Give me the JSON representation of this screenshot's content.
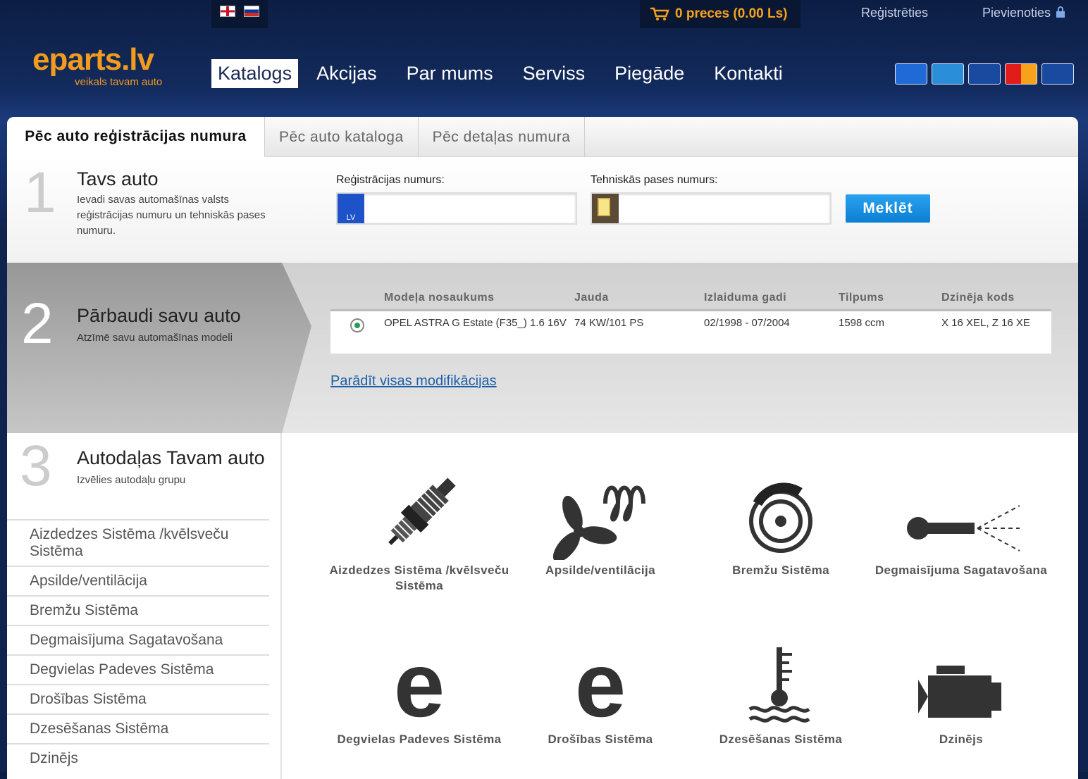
{
  "header": {
    "cart_text": "0 preces (0.00 Ls)",
    "register": "Reģistrēties",
    "login": "Pievienoties"
  },
  "logo": {
    "main": "eparts.lv",
    "tagline": "veikals tavam auto"
  },
  "nav": [
    "Katalogs",
    "Akcijas",
    "Par mums",
    "Serviss",
    "Piegāde",
    "Kontakti"
  ],
  "tabs": [
    "Pēc auto reģistrācijas numura",
    "Pēc auto kataloga",
    "Pēc detaļas numura"
  ],
  "step1": {
    "num": "1",
    "title": "Tavs auto",
    "desc": "Ievadi savas automašīnas valsts reģistrācijas numuru un tehniskās pases numuru.",
    "reg_label": "Reģistrācijas numurs:",
    "reg_badge": "LV",
    "pass_label": "Tehniskās pases numurs:",
    "search": "Meklēt"
  },
  "step2": {
    "num": "2",
    "title": "Pārbaudi savu auto",
    "desc": "Atzīmē savu automašīnas modeli",
    "columns": [
      "Modeļa nosaukums",
      "Jauda",
      "Izlaiduma gadi",
      "Tilpums",
      "Dzinēja kods"
    ],
    "row": {
      "model": "OPEL ASTRA G Estate (F35_) 1.6 16V",
      "power": "74 KW/101 PS",
      "years": "02/1998 - 07/2004",
      "volume": "1598 ccm",
      "engine": "X 16 XEL, Z 16 XE"
    },
    "show_all": "Parādīt visas modifikācijas"
  },
  "step3": {
    "num": "3",
    "title": "Autodaļas Tavam auto",
    "desc": "Izvēlies autodaļu grupu",
    "side": [
      "Aizdedzes Sistēma /kvēlsveču Sistēma",
      "Apsilde/ventilācija",
      "Bremžu Sistēma",
      "Degmaisījuma Sagatavošana",
      "Degvielas Padeves Sistēma",
      "Drošības Sistēma",
      "Dzesēšanas Sistēma",
      "Dzinējs"
    ],
    "grid": [
      {
        "label": "Aizdedzes Sistēma /kvēlsveču Sistēma",
        "icon": "spark-plug-icon"
      },
      {
        "label": "Apsilde/ventilācija",
        "icon": "fan-heater-icon"
      },
      {
        "label": "Bremžu Sistēma",
        "icon": "brake-disc-icon"
      },
      {
        "label": "Degmaisījuma Sagatavošana",
        "icon": "injector-icon"
      },
      {
        "label": "Degvielas Padeves Sistēma",
        "icon": "e-placeholder-icon"
      },
      {
        "label": "Drošības Sistēma",
        "icon": "e-placeholder-icon"
      },
      {
        "label": "Dzesēšanas Sistēma",
        "icon": "coolant-temp-icon"
      },
      {
        "label": "Dzinējs",
        "icon": "engine-icon"
      }
    ]
  },
  "colors": {
    "orange": "#f29b1d",
    "navy": "#0d1e44",
    "blue_button": "#1b8fe0"
  }
}
